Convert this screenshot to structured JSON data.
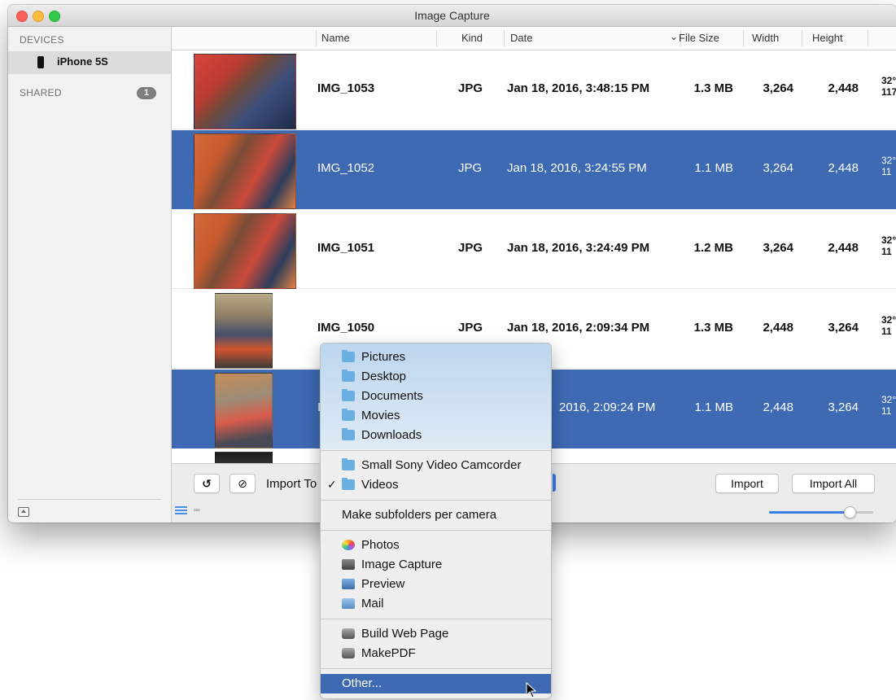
{
  "window": {
    "title": "Image Capture"
  },
  "sidebar": {
    "devices_header": "DEVICES",
    "device_name": "iPhone 5S",
    "shared_header": "SHARED",
    "shared_count": "1"
  },
  "columns": {
    "name": "Name",
    "kind": "Kind",
    "date": "Date",
    "file_size": "File Size",
    "width": "Width",
    "height": "Height"
  },
  "rows": [
    {
      "name": "IMG_1053",
      "kind": "JPG",
      "date": "Jan 18, 2016, 3:48:15 PM",
      "size": "1.3 MB",
      "width": "3,264",
      "height": "2,448",
      "extra1": "32°",
      "extra2": "117",
      "selected": false
    },
    {
      "name": "IMG_1052",
      "kind": "JPG",
      "date": "Jan 18, 2016, 3:24:55 PM",
      "size": "1.1 MB",
      "width": "3,264",
      "height": "2,448",
      "extra1": "32°",
      "extra2": "11",
      "selected": true
    },
    {
      "name": "IMG_1051",
      "kind": "JPG",
      "date": "Jan 18, 2016, 3:24:49 PM",
      "size": "1.2 MB",
      "width": "3,264",
      "height": "2,448",
      "extra1": "32°",
      "extra2": "11",
      "selected": false
    },
    {
      "name": "IMG_1050",
      "kind": "JPG",
      "date": "Jan 18, 2016, 2:09:34 PM",
      "size": "1.3 MB",
      "width": "2,448",
      "height": "3,264",
      "extra1": "32°",
      "extra2": "11",
      "selected": false
    },
    {
      "name": "I",
      "kind": "",
      "date": "2016, 2:09:24 PM",
      "size": "1.1 MB",
      "width": "2,448",
      "height": "3,264",
      "extra1": "32°",
      "extra2": "11",
      "selected": true
    }
  ],
  "bottombar": {
    "rotate_glyph": "↺",
    "delete_glyph": "⊘",
    "import_to_label": "Import To",
    "import_button": "Import",
    "import_all_button": "Import All"
  },
  "menu": {
    "folders": [
      "Pictures",
      "Desktop",
      "Documents",
      "Movies",
      "Downloads"
    ],
    "camcorder": "Small Sony Video Camcorder",
    "checked_item": "Videos",
    "check_glyph": "✓",
    "subfolders": "Make subfolders per camera",
    "apps": [
      "Photos",
      "Image Capture",
      "Preview",
      "Mail"
    ],
    "actions": [
      "Build Web Page",
      "MakePDF"
    ],
    "other": "Other..."
  },
  "colors": {
    "selection": "#3d6ab3",
    "accent": "#3b7de9"
  },
  "icons": {
    "device": "iphone-icon",
    "eject": "eject-icon",
    "list_view": "list-view-icon",
    "grid_view": "grid-view-icon"
  }
}
